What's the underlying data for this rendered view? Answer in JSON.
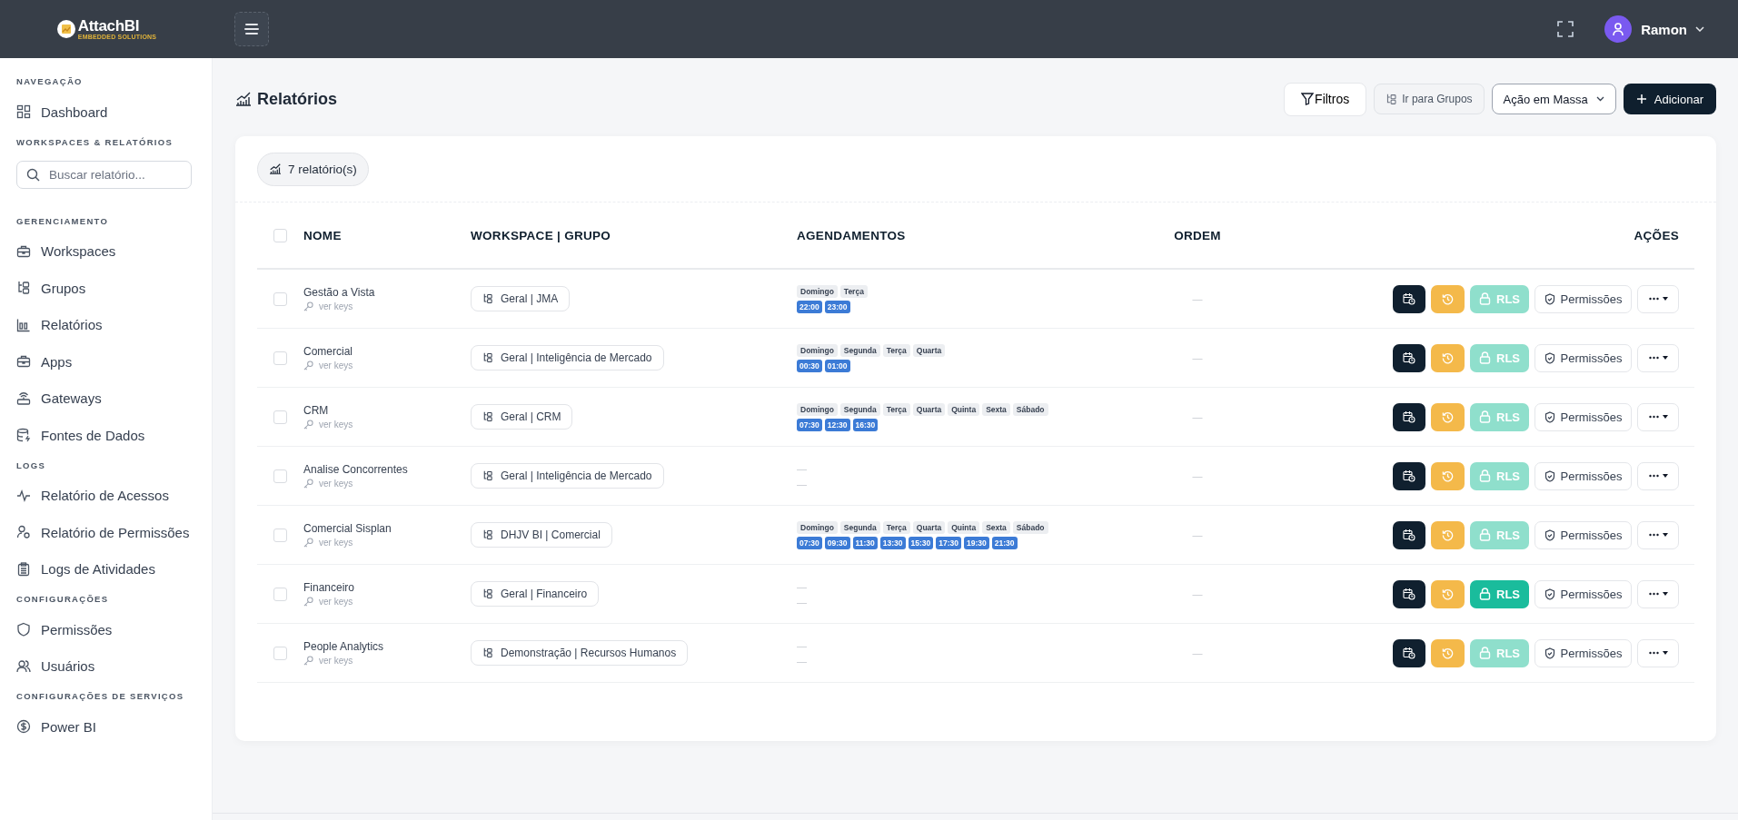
{
  "header": {
    "logo": {
      "name": "AttachBI",
      "tagline": "EMBEDDED SOLUTIONS"
    },
    "user": {
      "name": "Ramon"
    }
  },
  "sidebar": {
    "sections": [
      {
        "title": "NAVEGAÇÃO",
        "items": [
          {
            "label": "Dashboard"
          }
        ]
      },
      {
        "title": "WORKSPACES & RELATÓRIOS",
        "search": {
          "placeholder": "Buscar relatório..."
        }
      },
      {
        "title": "GERENCIAMENTO",
        "items": [
          {
            "label": "Workspaces"
          },
          {
            "label": "Grupos"
          },
          {
            "label": "Relatórios"
          },
          {
            "label": "Apps"
          },
          {
            "label": "Gateways"
          },
          {
            "label": "Fontes de Dados"
          }
        ]
      },
      {
        "title": "LOGS",
        "items": [
          {
            "label": "Relatório de Acessos"
          },
          {
            "label": "Relatório de Permissões"
          },
          {
            "label": "Logs de Atividades"
          }
        ]
      },
      {
        "title": "CONFIGURAÇÕES",
        "items": [
          {
            "label": "Permissões"
          },
          {
            "label": "Usuários"
          }
        ]
      },
      {
        "title": "CONFIGURAÇÕES DE SERVIÇOS",
        "items": [
          {
            "label": "Power BI"
          }
        ]
      }
    ]
  },
  "page": {
    "title": "Relatórios",
    "buttons": [
      {
        "kind": "filter",
        "label": "Filtros"
      },
      {
        "kind": "groups",
        "label": "Ir para Grupos"
      },
      {
        "kind": "dropdown",
        "label": "Ação em Massa"
      },
      {
        "kind": "primary",
        "label": "Adicionar"
      }
    ]
  },
  "summary": {
    "count": "7 relatório(s)"
  },
  "table": {
    "select_all": {
      "checked": false
    },
    "columns": [
      "NOME",
      "WORKSPACE | GRUPO",
      "AGENDAMENTOS",
      "ORDEM",
      "AÇÕES"
    ],
    "rows": [
      {
        "checked": false,
        "name": "Gestão a Vista",
        "keys": "ver keys",
        "workspace": "Geral | JMA",
        "days": [
          "Domingo",
          "Terça"
        ],
        "times": [
          "22:00",
          "23:00"
        ],
        "order": "—",
        "rls_active": false,
        "rls": "RLS",
        "permissions": "Permissões"
      },
      {
        "checked": false,
        "name": "Comercial",
        "keys": "ver keys",
        "workspace": "Geral | Inteligência de Mercado",
        "days": [
          "Domingo",
          "Segunda",
          "Terça",
          "Quarta"
        ],
        "times": [
          "00:30",
          "01:00"
        ],
        "order": "—",
        "rls_active": false,
        "rls": "RLS",
        "permissions": "Permissões"
      },
      {
        "checked": false,
        "name": "CRM",
        "keys": "ver keys",
        "workspace": "Geral | CRM",
        "days": [
          "Domingo",
          "Segunda",
          "Terça",
          "Quarta",
          "Quinta",
          "Sexta",
          "Sábado"
        ],
        "times": [
          "07:30",
          "12:30",
          "16:30"
        ],
        "order": "—",
        "rls_active": false,
        "rls": "RLS",
        "permissions": "Permissões"
      },
      {
        "checked": false,
        "name": "Analise Concorrentes",
        "keys": "ver keys",
        "workspace": "Geral | Inteligência de Mercado",
        "no_schedule": [
          "—",
          "—"
        ],
        "order": "—",
        "rls_active": false,
        "rls": "RLS",
        "permissions": "Permissões"
      },
      {
        "checked": false,
        "name": "Comercial Sisplan",
        "keys": "ver keys",
        "workspace": "DHJV BI | Comercial",
        "days": [
          "Domingo",
          "Segunda",
          "Terça",
          "Quarta",
          "Quinta",
          "Sexta",
          "Sábado"
        ],
        "times": [
          "07:30",
          "09:30",
          "11:30",
          "13:30",
          "15:30",
          "17:30",
          "19:30",
          "21:30"
        ],
        "order": "—",
        "rls_active": false,
        "rls": "RLS",
        "permissions": "Permissões"
      },
      {
        "checked": false,
        "name": "Financeiro",
        "keys": "ver keys",
        "workspace": "Geral | Financeiro",
        "no_schedule": [
          "—",
          "—"
        ],
        "order": "—",
        "rls_active": true,
        "rls": "RLS",
        "permissions": "Permissões"
      },
      {
        "checked": false,
        "name": "People Analytics",
        "keys": "ver keys",
        "workspace": "Demonstração | Recursos Humanos",
        "no_schedule": [
          "—",
          "—"
        ],
        "order": "—",
        "rls_active": false,
        "rls": "RLS",
        "permissions": "Permissões"
      }
    ]
  }
}
